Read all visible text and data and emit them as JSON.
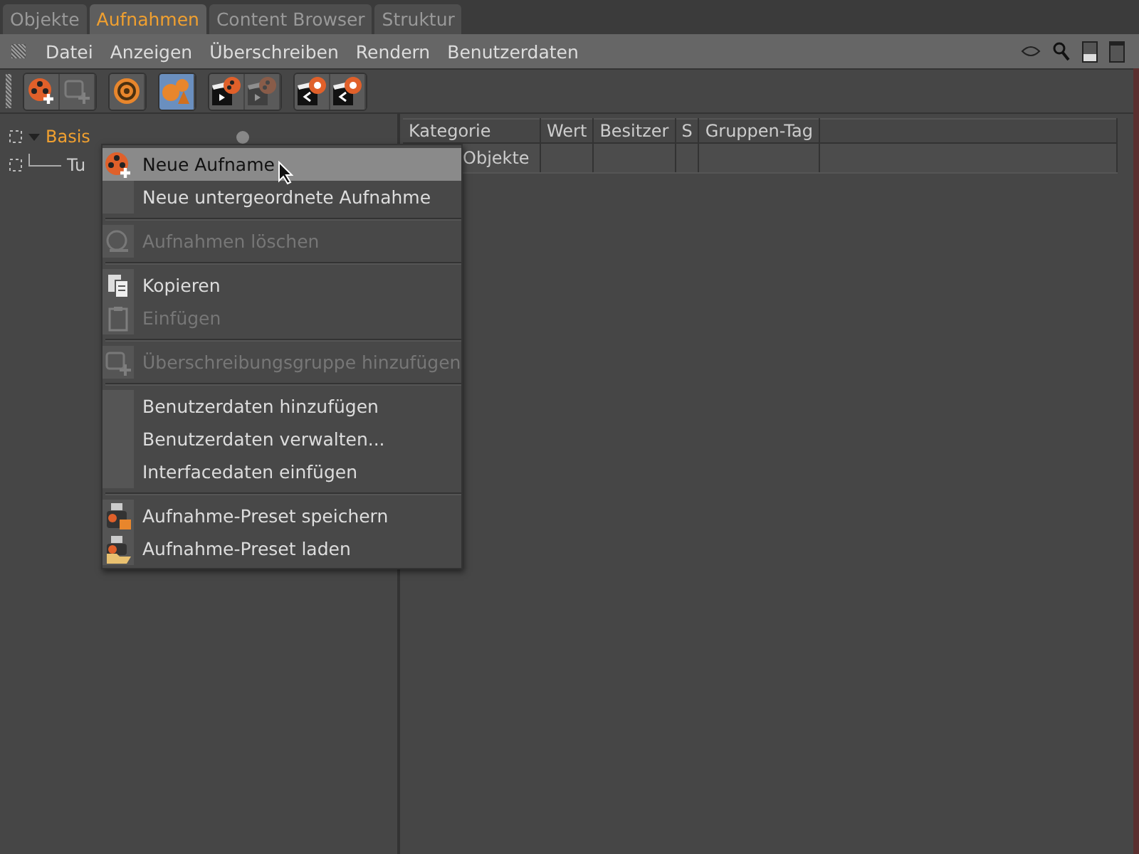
{
  "tabs": [
    {
      "label": "Objekte",
      "selected": false
    },
    {
      "label": "Aufnahmen",
      "selected": true
    },
    {
      "label": "Content Browser",
      "selected": false
    },
    {
      "label": "Struktur",
      "selected": false
    }
  ],
  "menubar": [
    "Datei",
    "Anzeigen",
    "Überschreiben",
    "Rendern",
    "Benutzerdaten"
  ],
  "toolbar": [
    [
      {
        "kind": "reel-add",
        "disabled": false,
        "selected": false
      },
      {
        "kind": "group-add",
        "disabled": true,
        "selected": false
      }
    ],
    [
      {
        "kind": "ring",
        "disabled": false,
        "selected": false
      }
    ],
    [
      {
        "kind": "shapes",
        "disabled": false,
        "selected": true
      }
    ],
    [
      {
        "kind": "clapper-reel",
        "disabled": false,
        "selected": false
      },
      {
        "kind": "clapper-reel",
        "disabled": true,
        "selected": false
      }
    ],
    [
      {
        "kind": "clapper-share",
        "disabled": false,
        "selected": false
      },
      {
        "kind": "clapper-share",
        "disabled": false,
        "selected": false
      }
    ]
  ],
  "tree": [
    {
      "label": "Basis",
      "selected": true,
      "expanded": true,
      "children": [
        {
          "label": "Tu",
          "selected": false
        }
      ]
    }
  ],
  "table": {
    "columns": [
      "Kategorie",
      "Wert",
      "Besitzer",
      "S",
      "Gruppen-Tag"
    ],
    "rows": [
      [
        "Objekte",
        "",
        "",
        "",
        ""
      ]
    ]
  },
  "context_menu": [
    {
      "kind": "reel-add",
      "label": "Neue Aufname",
      "disabled": false,
      "selected": true
    },
    {
      "kind": "plain",
      "label": "Neue untergeordnete Aufnahme",
      "disabled": false,
      "selected": false
    },
    {
      "kind": "separator"
    },
    {
      "kind": "trash",
      "label": "Aufnahmen löschen",
      "disabled": true,
      "selected": false
    },
    {
      "kind": "separator"
    },
    {
      "kind": "copy",
      "label": "Kopieren",
      "disabled": false,
      "selected": false
    },
    {
      "kind": "paste",
      "label": "Einfügen",
      "disabled": true,
      "selected": false
    },
    {
      "kind": "separator"
    },
    {
      "kind": "group-add",
      "label": "Überschreibungsgruppe hinzufügen",
      "disabled": true,
      "selected": false
    },
    {
      "kind": "separator"
    },
    {
      "kind": "plain",
      "label": "Benutzerdaten hinzufügen",
      "disabled": false,
      "selected": false
    },
    {
      "kind": "plain",
      "label": "Benutzerdaten verwalten...",
      "disabled": false,
      "selected": false
    },
    {
      "kind": "plain",
      "label": "Interfacedaten einfügen",
      "disabled": false,
      "selected": false
    },
    {
      "kind": "separator"
    },
    {
      "kind": "preset-save",
      "label": "Aufnahme-Preset speichern",
      "disabled": false,
      "selected": false
    },
    {
      "kind": "preset-load",
      "label": "Aufnahme-Preset laden",
      "disabled": false,
      "selected": false
    }
  ]
}
